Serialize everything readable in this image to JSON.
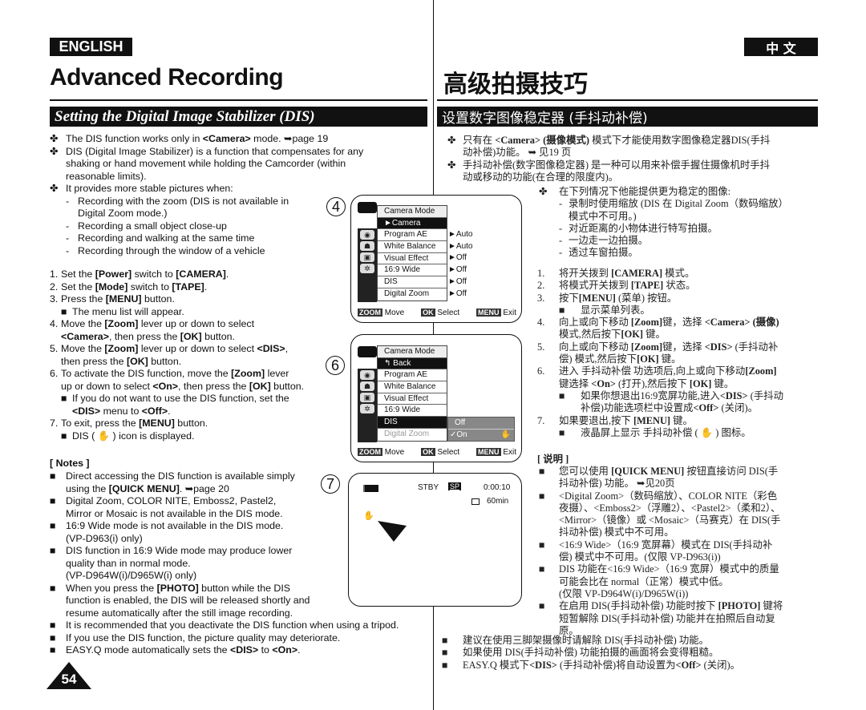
{
  "header": {
    "lang_en": "ENGLISH",
    "lang_zh": "中 文",
    "title_en": "Advanced Recording",
    "title_zh": "高级拍摄技巧",
    "section_en": "Setting the Digital Image Stabilizer (DIS)",
    "section_zh": "设置数字图像稳定器 (手抖动补偿)"
  },
  "left": {
    "intro": [
      {
        "mk": "✤",
        "lines": [
          "The DIS function works only in *<Camera>* mode. ➥page 19"
        ]
      },
      {
        "mk": "✤",
        "lines": [
          "DIS (Digital Image Stabilizer) is a function that compensates for any",
          "shaking or hand movement while holding the Camcorder (within",
          "reasonable limits)."
        ]
      },
      {
        "mk": "✤",
        "lines": [
          "It provides more stable pictures when:"
        ],
        "subs": [
          {
            "mk": "-",
            "lines": [
              "Recording with the zoom (DIS is not available in",
              "Digital Zoom mode.)"
            ]
          },
          {
            "mk": "-",
            "lines": [
              "Recording a small object close-up"
            ]
          },
          {
            "mk": "-",
            "lines": [
              "Recording and walking at the same time"
            ]
          },
          {
            "mk": "-",
            "lines": [
              "Recording through the window of a vehicle"
            ]
          }
        ]
      }
    ],
    "steps": [
      {
        "mk": "1.",
        "lines": [
          "Set the *[Power]* switch to *[CAMERA]*."
        ]
      },
      {
        "mk": "2.",
        "lines": [
          "Set the *[Mode]* switch to *[TAPE]*."
        ]
      },
      {
        "mk": "3.",
        "lines": [
          "Press the *[MENU]* button."
        ],
        "subs": [
          {
            "mk": "■",
            "lines": [
              "The menu list will appear."
            ]
          }
        ]
      },
      {
        "mk": "4.",
        "lines": [
          "Move the *[Zoom]* lever up or down to select",
          "*<Camera>*, then press the *[OK]* button."
        ]
      },
      {
        "mk": "5.",
        "lines": [
          "Move the *[Zoom]* lever up or down to select *<DIS>*,",
          "then press the *[OK]* button."
        ]
      },
      {
        "mk": "6.",
        "lines": [
          "To activate the DIS function, move the *[Zoom]* lever",
          "up or down to select *<On>*, then press the *[OK]* button."
        ],
        "subs": [
          {
            "mk": "■",
            "lines": [
              "If you do not want to use the DIS function, set the",
              "*<DIS>* menu to *<Off>*."
            ]
          }
        ]
      },
      {
        "mk": "7.",
        "lines": [
          "To exit, press the *[MENU]* button."
        ],
        "subs": [
          {
            "mk": "■",
            "lines": [
              "DIS ( ✋ ) icon is displayed."
            ]
          }
        ]
      }
    ],
    "notes_title": "[ Notes ]",
    "notes": [
      {
        "mk": "■",
        "lines": [
          "Direct accessing the DIS function is available simply",
          "using the *[QUICK MENU]*. ➥page 20"
        ]
      },
      {
        "mk": "■",
        "lines": [
          "Digital Zoom, COLOR NITE, Emboss2, Pastel2,",
          "Mirror or Mosaic is not available in the DIS mode."
        ]
      },
      {
        "mk": "■",
        "lines": [
          "16:9 Wide mode is not available in the DIS mode.",
          "(VP-D963(i) only)"
        ]
      },
      {
        "mk": "■",
        "lines": [
          "DIS function in 16:9 Wide mode may produce lower",
          "quality than in normal mode.",
          "(VP-D964W(i)/D965W(i) only)"
        ]
      },
      {
        "mk": "■",
        "lines": [
          "When you press the *[PHOTO]* button while the DIS",
          "function is enabled, the DIS will be released shortly and",
          "resume automatically after the still image recording."
        ]
      },
      {
        "mk": "■",
        "lines": [
          "It is recommended that you deactivate the DIS function when using a tripod."
        ]
      },
      {
        "mk": "■",
        "lines": [
          "If you use the DIS function, the picture quality may deteriorate."
        ]
      },
      {
        "mk": "■",
        "lines": [
          "EASY.Q mode automatically sets the *<DIS>* to *<On>*."
        ]
      }
    ]
  },
  "right": {
    "intro": [
      {
        "mk": "✤",
        "lines": [
          "只有在 *<Camera>* *(摄像模式)* 模式下才能使用数字图像稳定器DIS(手抖",
          "动补偿)功能。 ➥ 见19 页"
        ]
      },
      {
        "mk": "✤",
        "lines": [
          "手抖动补偿(数字图像稳定器) 是一种可以用来补偿手握住摄像机时手抖",
          "动或移动的功能(在合理的限度内)。"
        ]
      }
    ],
    "cases": {
      "mk": "✤",
      "lines": [
        "在下列情况下他能提供更为稳定的图像:"
      ],
      "subs": [
        {
          "mk": "-",
          "lines": [
            "录制时使用缩放 (DIS 在 Digital Zoom（数码缩放）",
            "模式中不可用。)"
          ]
        },
        {
          "mk": "-",
          "lines": [
            "对近距离的小物体进行特写拍摄。"
          ]
        },
        {
          "mk": "-",
          "lines": [
            "一边走一边拍摄。"
          ]
        },
        {
          "mk": "-",
          "lines": [
            "透过车窗拍摄。"
          ]
        }
      ]
    },
    "steps": [
      {
        "mk": "1.",
        "lines": [
          "将开关拨到 *[CAMERA]* 模式。"
        ]
      },
      {
        "mk": "2.",
        "lines": [
          "将模式开关拨到 *[TAPE]* 状态。"
        ]
      },
      {
        "mk": "3.",
        "lines": [
          "按下*[MENU]* (菜单) 按钮。"
        ],
        "subs": [
          {
            "mk": "■",
            "lines": [
              "显示菜单列表。"
            ]
          }
        ]
      },
      {
        "mk": "4.",
        "lines": [
          "向上或向下移动 *[Zoom]*键，选择 *<Camera> (摄像)*",
          "模式,然后按下*[OK]* 键。"
        ]
      },
      {
        "mk": "5.",
        "lines": [
          "向上或向下移动 *[Zoom]*键，选择 *<DIS>* (手抖动补",
          "偿) 模式,然后按下*[OK]* 键。"
        ]
      },
      {
        "mk": "6.",
        "lines": [
          "进入 手抖动补偿 功选项后,向上或向下移动*[Zoom]*",
          "键选择 *<On>* (打开),然后按下 *[OK]* 键。"
        ],
        "subs": [
          {
            "mk": "■",
            "lines": [
              "如果你想退出16:9宽屏功能,进入*<DIS>* (手抖动",
              "补偿)功能选项栏中设置成*<Off>* (关闭)。"
            ]
          }
        ]
      },
      {
        "mk": "7.",
        "lines": [
          "如果要退出,按下 *[MENU]* 键。"
        ],
        "subs": [
          {
            "mk": "■",
            "lines": [
              "液晶屏上显示 手抖动补偿 ( ✋ ) 图标。"
            ]
          }
        ]
      }
    ],
    "notes_title": "[ 说明 ]",
    "notes": [
      {
        "mk": "■",
        "lines": [
          "您可以使用 *[QUICK MENU]* 按钮直接访问 DIS(手",
          "抖动补偿) 功能。 ➥见20页"
        ]
      },
      {
        "mk": "■",
        "lines": [
          "<Digital Zoom>（数码缩放）、COLOR NITE（彩色",
          "夜摄）、<Emboss2>（浮雕2）、<Pastel2>（柔和2）、",
          "<Mirror>（镜像）或 <Mosaic>（马赛克）在 DIS(手",
          "抖动补偿) 模式中不可用。"
        ]
      },
      {
        "mk": "■",
        "lines": [
          "<16:9 Wide>（16:9 宽屏幕）模式在 DIS(手抖动补",
          "偿) 模式中不可用。(仅限 VP-D963(i))"
        ]
      },
      {
        "mk": "■",
        "lines": [
          "DIS 功能在<16:9 Wide>（16:9 宽屏）模式中的质量",
          "可能会比在 normal（正常）模式中低。",
          "(仅限 VP-D964W(i)/D965W(i))"
        ]
      },
      {
        "mk": "■",
        "lines": [
          "在启用 DIS(手抖动补偿) 功能时按下 *[PHOTO]* 键将",
          "短暂解除 DIS(手抖动补偿) 功能并在拍照后自动复",
          "原。"
        ]
      }
    ],
    "bottom": [
      {
        "mk": "■",
        "lines": [
          "建议在使用三脚架摄像时请解除 DIS(手抖动补偿) 功能。"
        ]
      },
      {
        "mk": "■",
        "lines": [
          "如果使用 DIS(手抖动补偿) 功能拍摄的画面将会变得粗糙。"
        ]
      },
      {
        "mk": "■",
        "lines": [
          "EASY.Q 模式下*<DIS>* (手抖动补偿)将自动设置为*<Off>* (关闭)。"
        ]
      }
    ]
  },
  "screens": {
    "s4": {
      "num": "4",
      "rows": [
        "Camera Mode",
        "►Camera",
        "Program AE",
        "White Balance",
        "Visual Effect",
        "16:9 Wide",
        "DIS",
        "Digital Zoom"
      ],
      "values": [
        "►Auto",
        "►Auto",
        "►Off",
        "►Off",
        "►Off",
        "►Off"
      ]
    },
    "s6": {
      "num": "6",
      "rows": [
        "Camera Mode",
        "↰ Back",
        "Program AE",
        "White Balance",
        "Visual Effect",
        "16:9 Wide",
        "DIS",
        "Digital Zoom"
      ],
      "options": [
        "Off",
        "✓On"
      ]
    },
    "footer": {
      "zoom_key": "ZOOM",
      "zoom_label": "Move",
      "ok_key": "OK",
      "ok_label": "Select",
      "menu_key": "MENU",
      "menu_label": "Exit"
    },
    "s7": {
      "num": "7",
      "status": "STBY",
      "speed": "SP",
      "time": "0:00:10",
      "remaining": "60min"
    }
  },
  "page_number": "54"
}
